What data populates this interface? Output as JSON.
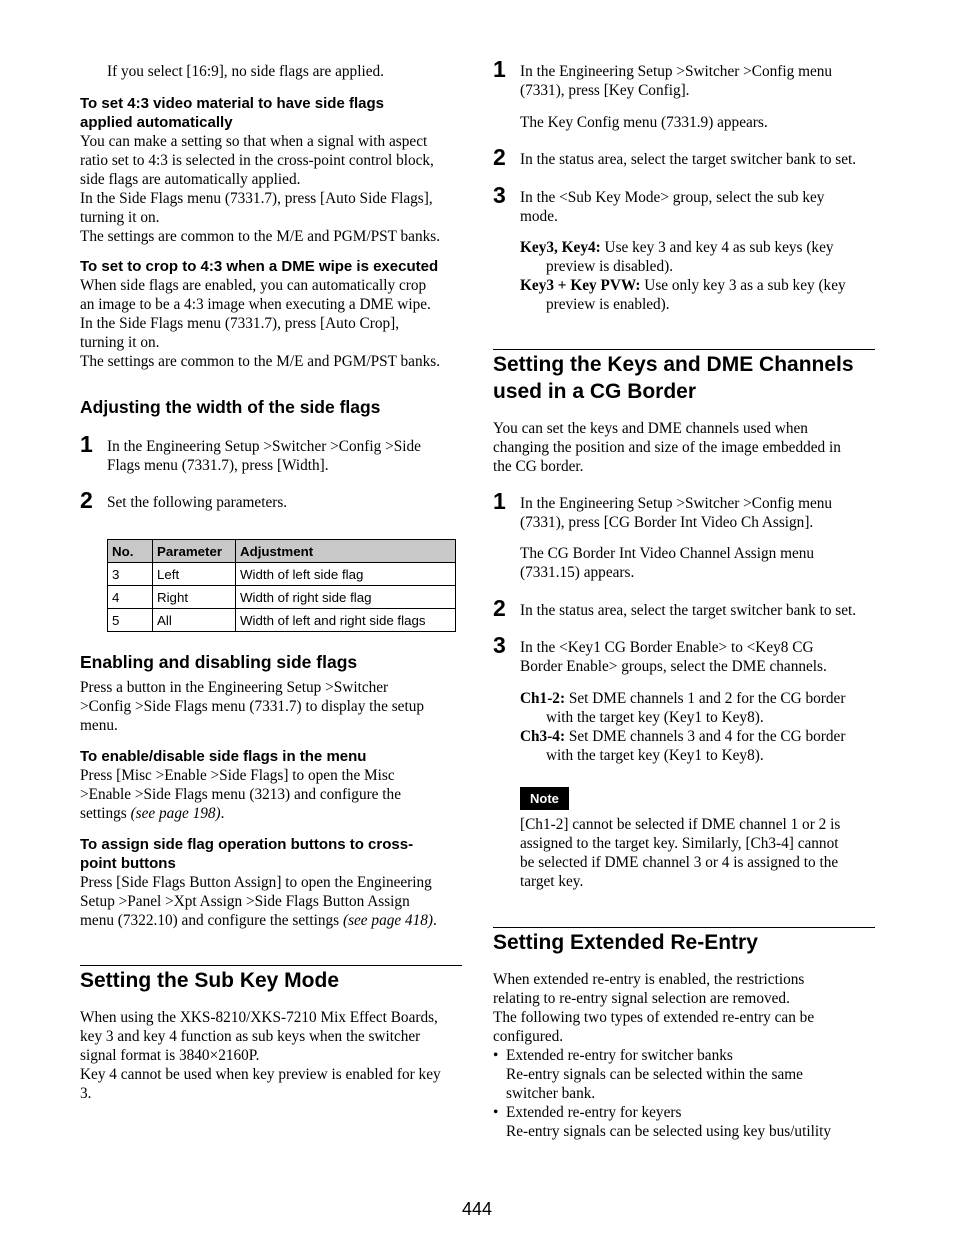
{
  "page_number": "444",
  "left": {
    "intro_line": "If you select [16:9], no side flags are applied.",
    "auto_side_flags": {
      "heading": "To set 4:3 video material to have side flags applied automatically",
      "heading_line1": "To set 4:3 video material to have side flags",
      "heading_line2": "applied automatically",
      "lines": [
        "You can make a setting so that when a signal with aspect",
        "ratio set to 4:3 is selected in the cross-point control block,",
        "side flags are automatically applied.",
        "In the Side Flags menu (7331.7), press [Auto Side Flags],",
        "turning it on.",
        "The settings are common to the M/E and PGM/PST banks."
      ]
    },
    "auto_crop": {
      "heading": "To set to crop to 4:3 when a DME wipe is executed",
      "lines": [
        "When side flags are enabled, you can automatically crop",
        "an image to be a 4:3 image when executing a DME wipe.",
        "In the Side Flags menu (7331.7), press [Auto Crop],",
        "turning it on.",
        "The settings are common to the M/E and PGM/PST banks."
      ]
    },
    "adjust_width": {
      "heading": "Adjusting the width of the side flags",
      "steps": [
        {
          "num": "1",
          "line1": "In the Engineering Setup >Switcher >Config >Side",
          "line2": "Flags menu (7331.7), press [Width]."
        },
        {
          "num": "2",
          "line1": "Set the following parameters."
        }
      ],
      "table": {
        "headers": [
          "No.",
          "Parameter",
          "Adjustment"
        ],
        "rows": [
          [
            "3",
            "Left",
            "Width of left side flag"
          ],
          [
            "4",
            "Right",
            "Width of right side flag"
          ],
          [
            "5",
            "All",
            "Width of left and right side flags"
          ]
        ]
      }
    },
    "enable_disable": {
      "heading": "Enabling and disabling side flags",
      "lines": [
        "Press a button in the Engineering Setup >Switcher",
        ">Config >Side Flags menu (7331.7) to display the setup",
        "menu."
      ]
    },
    "enable_in_menu": {
      "heading": "To enable/disable side flags in the menu",
      "lines": [
        "Press [Misc >Enable >Side Flags] to open the Misc",
        ">Enable >Side Flags menu (3213) and configure the"
      ],
      "last_line_prefix": "settings ",
      "last_line_ref": "(see page 198)",
      "last_line_suffix": "."
    },
    "assign_buttons": {
      "heading_line1": "To assign side flag operation buttons to cross-",
      "heading_line2": "point buttons",
      "lines": [
        "Press [Side Flags Button Assign] to open the Engineering",
        "Setup >Panel >Xpt Assign >Side Flags Button Assign"
      ],
      "last_line_prefix": "menu (7322.10) and configure the settings ",
      "last_line_ref": "(see page 418)",
      "last_line_suffix": "."
    },
    "sub_key_mode": {
      "heading": "Setting the Sub Key Mode",
      "lines": [
        "When using the XKS-8210/XKS-7210 Mix Effect Boards,",
        "key 3 and key 4 function as sub keys when the switcher",
        "signal format is 3840×2160P.",
        "Key 4 cannot be used when key preview is enabled for key",
        "3."
      ]
    }
  },
  "right": {
    "sub_key_steps": [
      {
        "num": "1",
        "line1": "In the Engineering Setup >Switcher >Config menu",
        "line2": "(7331), press [Key Config].",
        "result": "The Key Config menu (7331.9) appears."
      },
      {
        "num": "2",
        "line1": "In the status area, select the target switcher bank to set."
      },
      {
        "num": "3",
        "line1": "In the <Sub Key Mode> group, select the sub key",
        "line2": "mode."
      }
    ],
    "sub_key_options": [
      {
        "term": "Key3, Key4:",
        "line1": " Use key 3 and key 4 as sub keys (key",
        "line2": "preview is disabled)."
      },
      {
        "term": "Key3 + Key PVW:",
        "line1": " Use only key 3 as a sub key (key",
        "line2": "preview is enabled)."
      }
    ],
    "cg_border": {
      "heading_line1": "Setting the Keys and DME Channels",
      "heading_line2": "used in a CG Border",
      "lines": [
        "You can set the keys and DME channels used when",
        "changing the position and size of the image embedded in",
        "the CG border."
      ],
      "steps": [
        {
          "num": "1",
          "line1": "In the Engineering Setup >Switcher >Config menu",
          "line2": "(7331), press [CG Border Int Video Ch Assign].",
          "result1": "The CG Border Int Video Channel Assign menu",
          "result2": "(7331.15) appears."
        },
        {
          "num": "2",
          "line1": "In the status area, select the target switcher bank to set."
        },
        {
          "num": "3",
          "line1": "In the <Key1 CG Border Enable> to <Key8 CG",
          "line2": "Border Enable> groups, select the DME channels."
        }
      ],
      "options": [
        {
          "term": "Ch1-2:",
          "line1": " Set DME channels 1 and 2 for the CG border",
          "line2": "with the target key (Key1 to Key8)."
        },
        {
          "term": "Ch3-4:",
          "line1": " Set DME channels 3 and 4 for the CG border",
          "line2": "with the target key (Key1 to Key8)."
        }
      ],
      "note": {
        "label": "Note",
        "lines": [
          "[Ch1-2] cannot be selected if DME channel 1 or 2 is",
          "assigned to the target key. Similarly, [Ch3-4] cannot",
          "be selected if DME channel 3 or 4 is assigned to the",
          "target key."
        ]
      }
    },
    "extended_reentry": {
      "heading": "Setting Extended Re-Entry",
      "lines": [
        "When extended re-entry is enabled, the restrictions",
        "relating to re-entry signal selection are removed.",
        "The following two types of extended re-entry can be",
        "configured."
      ],
      "bullets": [
        {
          "title": "Extended re-entry for switcher banks",
          "lines": [
            "Re-entry signals can be selected within the same",
            "switcher bank."
          ]
        },
        {
          "title": "Extended re-entry for keyers",
          "lines": [
            "Re-entry signals can be selected using key bus/utility"
          ]
        }
      ],
      "bullet_glyph": "•"
    }
  }
}
